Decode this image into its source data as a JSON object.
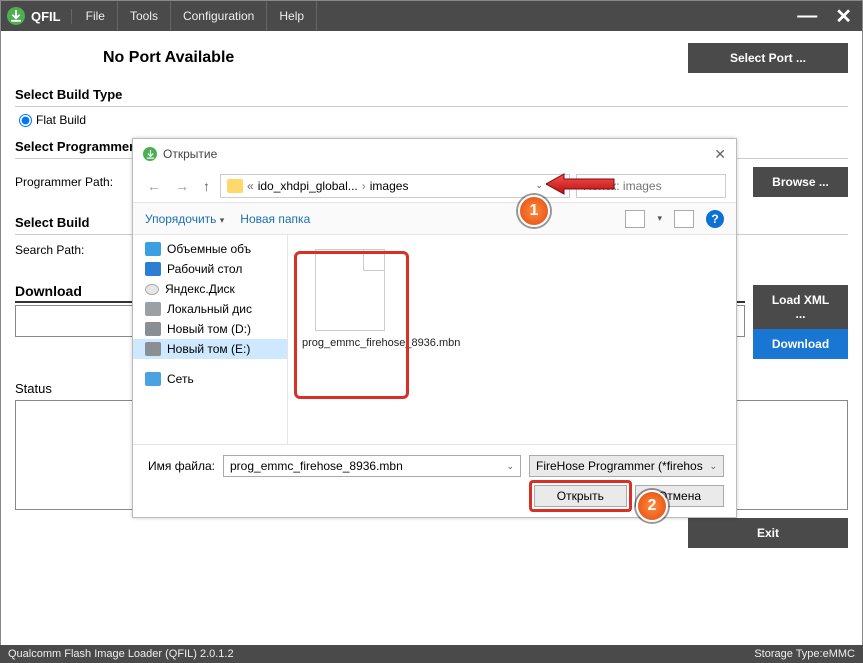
{
  "app": {
    "name": "QFIL"
  },
  "menu": {
    "file": "File",
    "tools": "Tools",
    "config": "Configuration",
    "help": "Help"
  },
  "port": {
    "status": "No Port Available",
    "select_btn": "Select Port ..."
  },
  "build": {
    "head": "Select Build Type",
    "flat": "Flat Build"
  },
  "prog": {
    "head": "Select Programmer",
    "path_label": "Programmer Path:",
    "browse": "Browse ..."
  },
  "buildsel": {
    "head": "Select Build",
    "search": "Search Path:"
  },
  "download": {
    "head": "Download",
    "load_xml": "Load XML ...",
    "download": "Download",
    "status": "Status"
  },
  "footer": {
    "exit": "Exit"
  },
  "statusbar": {
    "left": "Qualcomm Flash Image Loader (QFIL)   2.0.1.2",
    "right": "Storage Type:eMMC"
  },
  "dialog": {
    "title": "Открытие",
    "crumbs": {
      "sep": "«",
      "p1": "ido_xhdpi_global...",
      "p2": "images"
    },
    "search_placeholder": "Поиск: images",
    "toolbar": {
      "organize": "Упорядочить",
      "newfolder": "Новая папка"
    },
    "sidebar": {
      "volumes": "Объемные объ",
      "desktop": "Рабочий стол",
      "yadisk": "Яндекс.Диск",
      "localdisk": "Локальный дис",
      "drive_d": "Новый том (D:)",
      "drive_e": "Новый том (E:)",
      "network": "Сеть"
    },
    "file": {
      "name_display": "prog_emmc_firehose_8936.mbn"
    },
    "footer": {
      "fn_label": "Имя файла:",
      "fn_value": "prog_emmc_firehose_8936.mbn",
      "filter": "FireHose Programmer (*firehos",
      "open": "Открыть",
      "cancel": "Отмена"
    }
  },
  "callouts": {
    "one": "1",
    "two": "2"
  }
}
